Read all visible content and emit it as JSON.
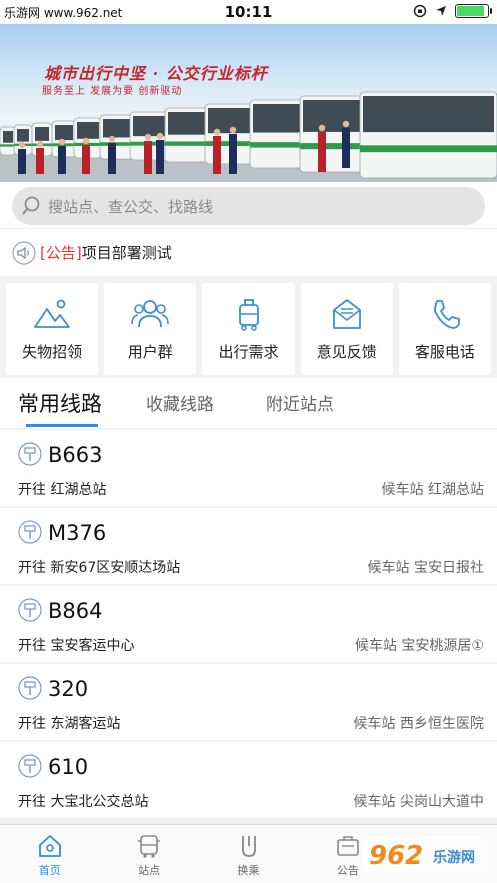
{
  "status_bar": {
    "left_text": "乐游网 www.962.net",
    "time": "10:11",
    "battery_level": 0.9
  },
  "banner": {
    "slogan": "城市出行中坚 · 公交行业标杆",
    "sub_slogan": "服务至上  发展为要  创新驱动"
  },
  "search": {
    "placeholder": "搜站点、查公交、找路线",
    "icon": "search-icon"
  },
  "notice": {
    "tag": "[公告]",
    "text": "项目部署测试",
    "icon": "speaker-icon"
  },
  "quick_actions": [
    {
      "label": "失物招领",
      "icon": "mountain-icon"
    },
    {
      "label": "用户群",
      "icon": "users-icon"
    },
    {
      "label": "出行需求",
      "icon": "luggage-icon"
    },
    {
      "label": "意见反馈",
      "icon": "mail-icon"
    },
    {
      "label": "客服电话",
      "icon": "phone-icon"
    }
  ],
  "tabs": [
    {
      "label": "常用线路",
      "active": true
    },
    {
      "label": "收藏线路",
      "active": false
    },
    {
      "label": "附近站点",
      "active": false
    }
  ],
  "routes": [
    {
      "number": "B663",
      "dest": "开往 红湖总站",
      "stop": "候车站 红湖总站"
    },
    {
      "number": "M376",
      "dest": "开往 新安67区安顺达场站",
      "stop": "候车站 宝安日报社"
    },
    {
      "number": "B864",
      "dest": "开往 宝安客运中心",
      "stop": "候车站 宝安桃源居①"
    },
    {
      "number": "320",
      "dest": "开往 东湖客运站",
      "stop": "候车站 西乡恒生医院"
    },
    {
      "number": "610",
      "dest": "开往 大宝北公交总站",
      "stop": "候车站 尖岗山大道中"
    }
  ],
  "bottom_nav": [
    {
      "label": "首页",
      "icon": "home-icon",
      "active": true
    },
    {
      "label": "站点",
      "icon": "bus-stop-icon",
      "active": false
    },
    {
      "label": "换乘",
      "icon": "transfer-icon",
      "active": false
    },
    {
      "label": "公告",
      "icon": "notice-icon",
      "active": false
    }
  ],
  "colors": {
    "accent": "#2d8ee8",
    "notice_tag": "#e33333",
    "slogan": "#c8232a"
  },
  "watermark": {
    "text": "962",
    "sub": "乐游网"
  }
}
